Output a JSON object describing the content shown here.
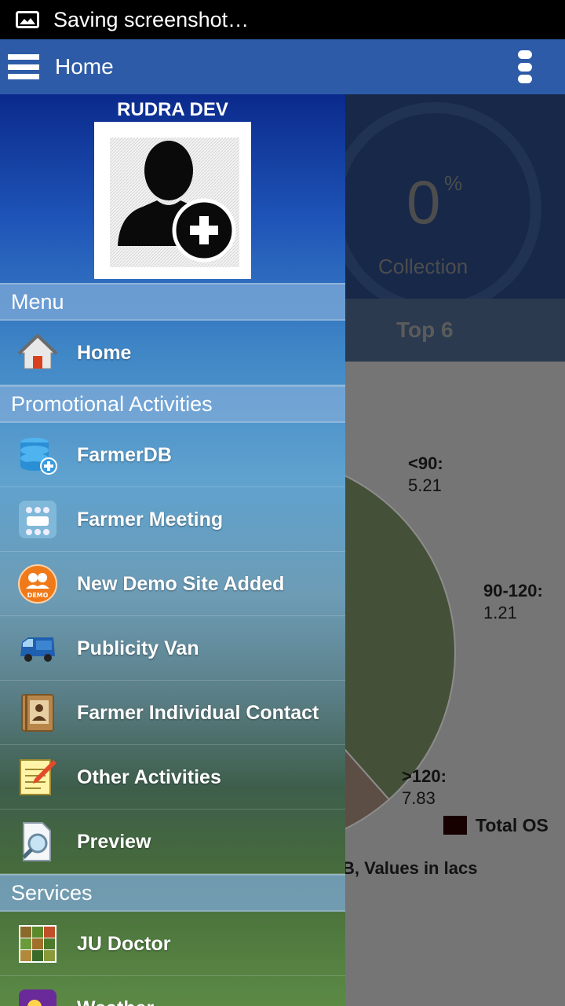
{
  "status_bar": {
    "text": "Saving screenshot…",
    "icon": "screenshot-image-icon"
  },
  "action_bar": {
    "title": "Home",
    "menu_icon": "hamburger-menu-icon",
    "overflow_icon": "overflow-menu-icon"
  },
  "drawer": {
    "user_name": "RUDRA DEV",
    "avatar_icon": "add-user-avatar-icon",
    "sections": [
      {
        "header": "Menu",
        "items": [
          {
            "label": "Home",
            "icon": "home-icon"
          }
        ]
      },
      {
        "header": "Promotional Activities",
        "items": [
          {
            "label": "FarmerDB",
            "icon": "database-add-icon"
          },
          {
            "label": "Farmer Meeting",
            "icon": "meeting-icon"
          },
          {
            "label": "New Demo Site Added",
            "icon": "demo-site-icon"
          },
          {
            "label": "Publicity Van",
            "icon": "van-icon"
          },
          {
            "label": "Farmer Individual Contact",
            "icon": "contact-book-icon"
          },
          {
            "label": "Other Activities",
            "icon": "notepad-pencil-icon"
          },
          {
            "label": "Preview",
            "icon": "preview-magnifier-icon"
          }
        ]
      },
      {
        "header": "Services",
        "items": [
          {
            "label": "JU Doctor",
            "icon": "ju-doctor-icon"
          },
          {
            "label": "Weather",
            "icon": "weather-icon"
          }
        ]
      }
    ]
  },
  "dashboard": {
    "gauge": {
      "value": "0",
      "unit": "%",
      "label": "Collection"
    },
    "tab_label": "Top 6",
    "legend_label": "Total OS",
    "note_text": "B, Values in lacs",
    "colors": {
      "slice_lt90": "#7e9366",
      "slice_90_120": "#a88e7f",
      "slice_gt120": "#c04a02",
      "legend": "#2a0000"
    }
  },
  "chart_data": {
    "type": "pie",
    "categories": [
      "<90",
      "90-120",
      ">120"
    ],
    "values": [
      5.21,
      1.21,
      7.83
    ],
    "data_labels": [
      {
        "name": "<90",
        "value": "5.21"
      },
      {
        "name": "90-120",
        "value": "1.21"
      },
      {
        "name": ">120",
        "value": "7.83"
      }
    ],
    "legend": [
      "Total OS"
    ],
    "note": "B, Values in lacs"
  }
}
